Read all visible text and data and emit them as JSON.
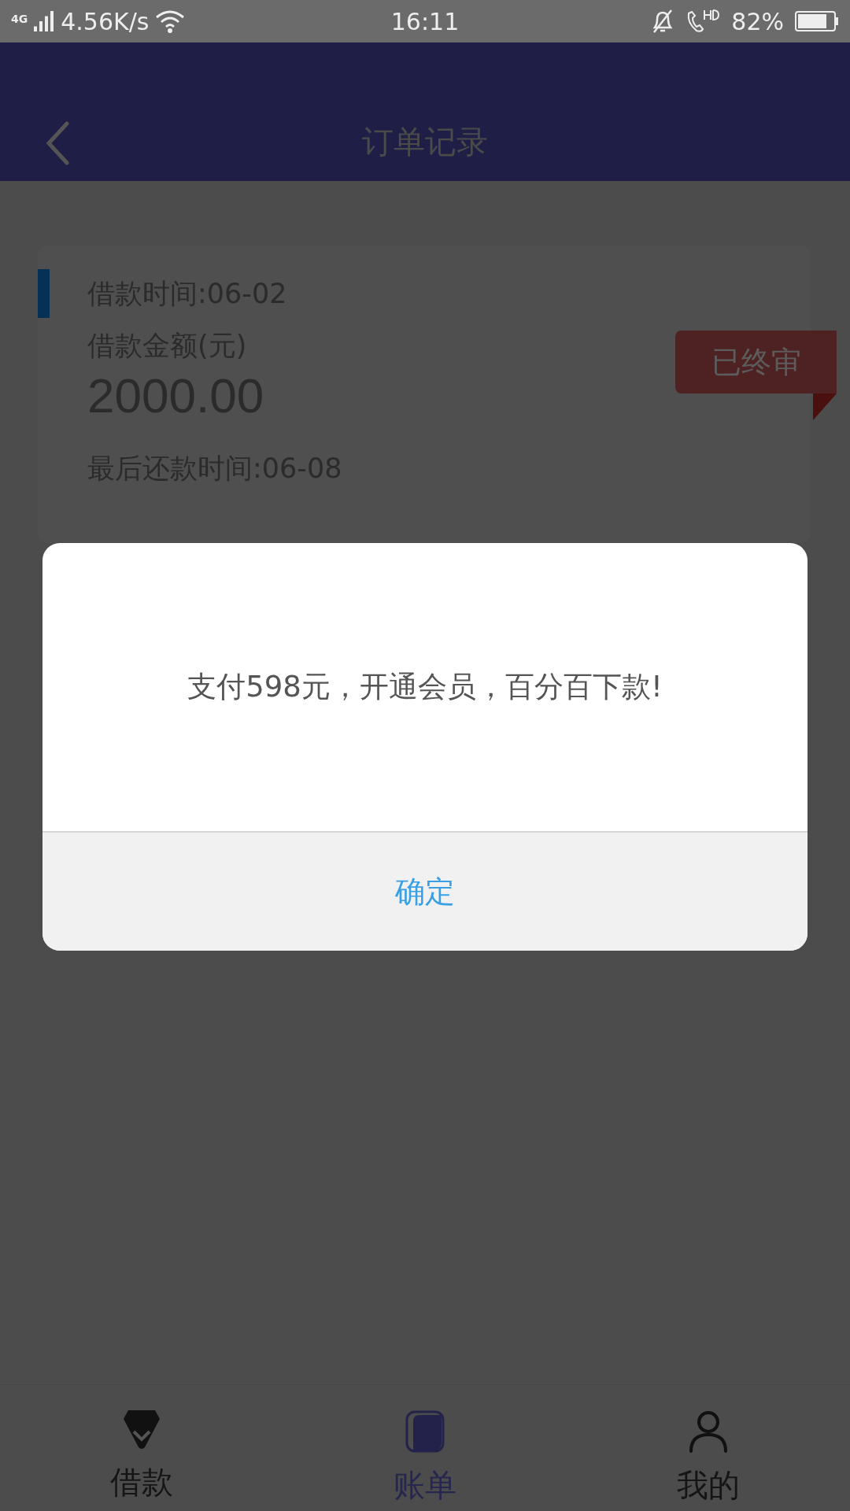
{
  "status_bar": {
    "network": "4G",
    "speed": "4.56K/s",
    "time": "16:11",
    "battery": "82%"
  },
  "header": {
    "title": "订单记录"
  },
  "order": {
    "loan_time": "借款时间:06-02",
    "amount_label": "借款金额(元)",
    "amount": "2000.00",
    "due_time": "最后还款时间:06-08",
    "status": "已终审"
  },
  "dialog": {
    "message": "支付598元，开通会员，百分百下款!",
    "button": "确定"
  },
  "tabs": [
    {
      "label": "借款",
      "selected": false
    },
    {
      "label": "账单",
      "selected": true
    },
    {
      "label": "我的",
      "selected": false
    }
  ]
}
